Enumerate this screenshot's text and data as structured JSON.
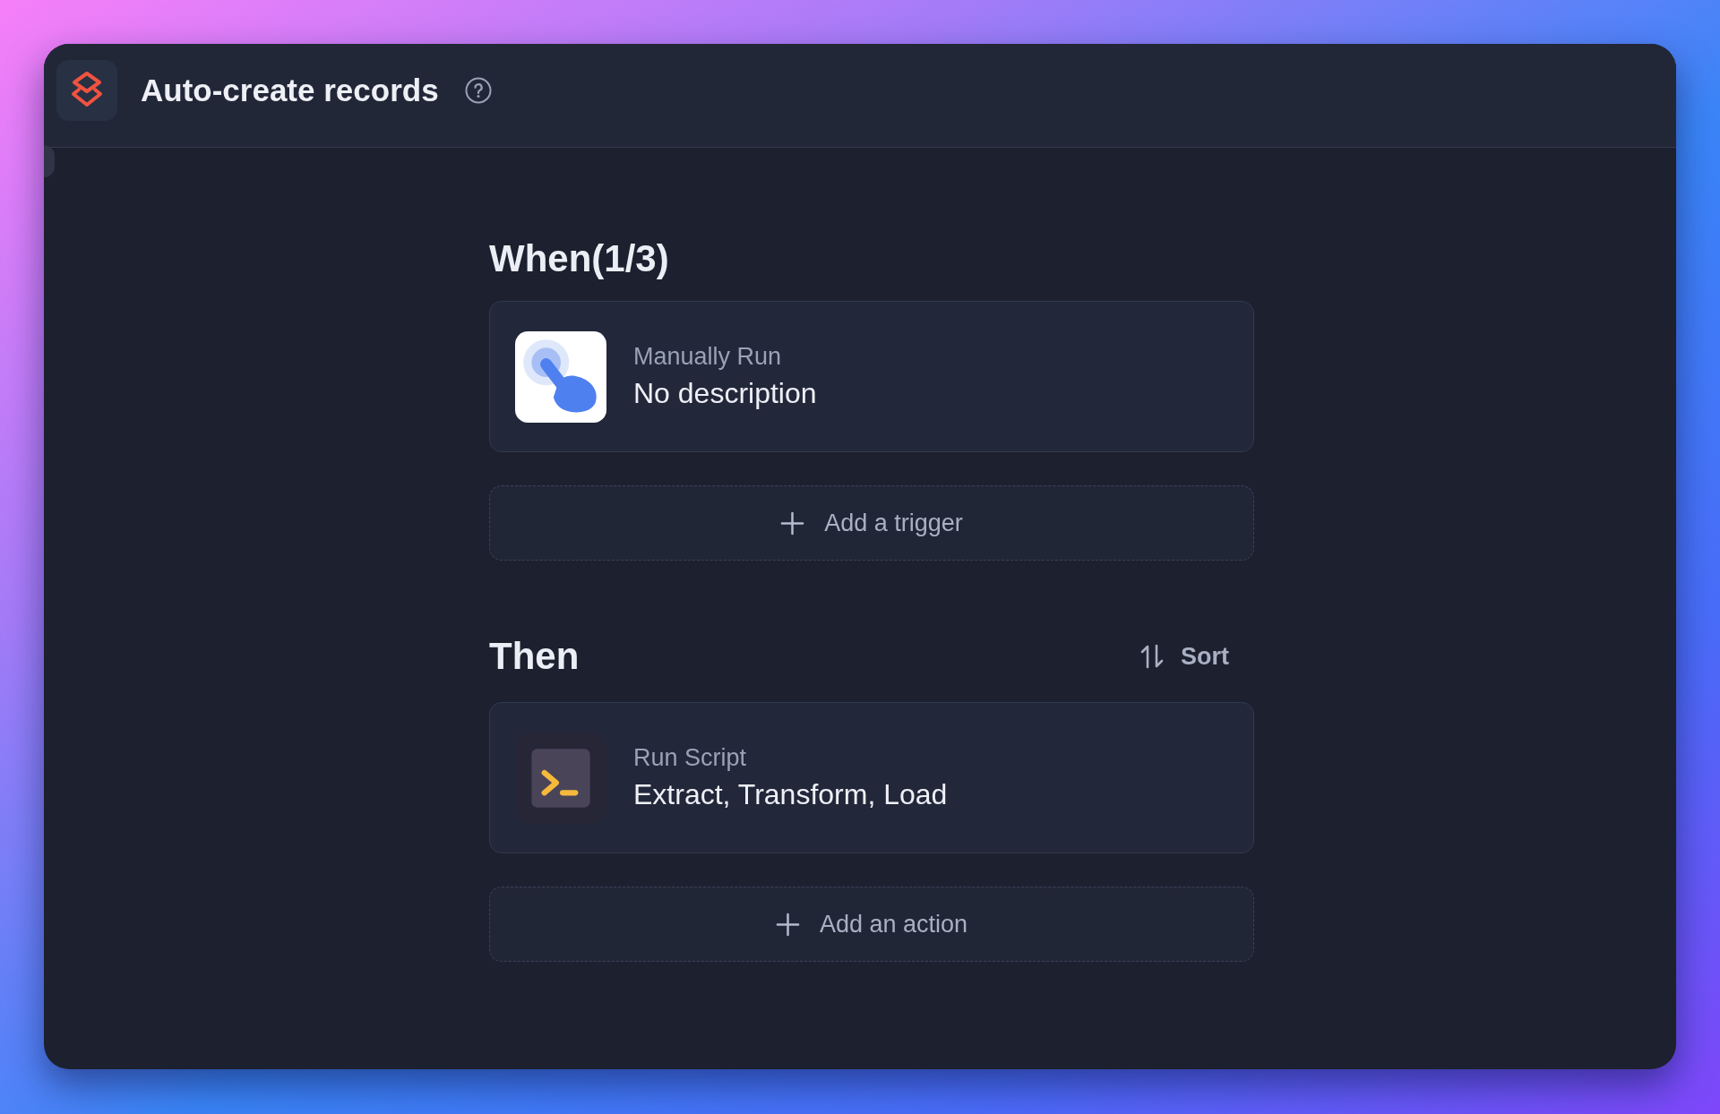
{
  "window": {
    "title": "Auto-create records"
  },
  "trigger_section": {
    "title": "When(1/3)",
    "items": [
      {
        "kind": "manual",
        "label": "Manually Run",
        "description": "No description"
      }
    ],
    "add_button": {
      "label": "Add a trigger"
    }
  },
  "action_section": {
    "title": "Then",
    "sort_button": {
      "label": "Sort"
    },
    "items": [
      {
        "kind": "script",
        "label": "Run Script",
        "description": "Extract, Transform, Load"
      }
    ],
    "add_button": {
      "label": "Add an action"
    }
  }
}
